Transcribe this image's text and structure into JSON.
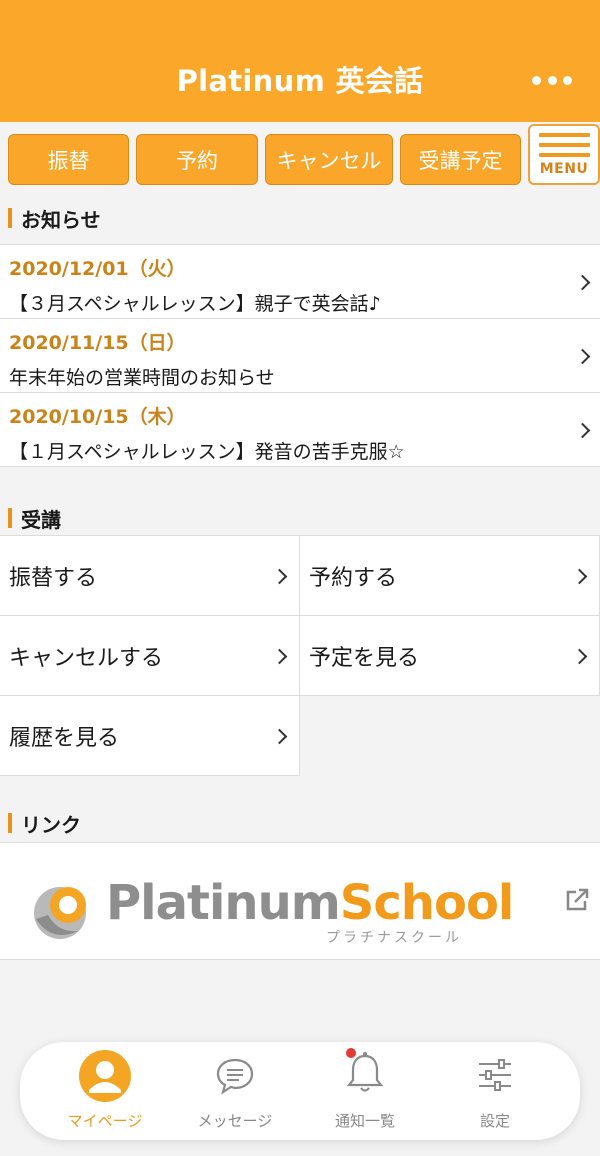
{
  "header": {
    "title": "Platinum 英会話",
    "more_icon": "more-dots-icon"
  },
  "quick_buttons": [
    "振替",
    "予約",
    "キャンセル",
    "受講予定"
  ],
  "menu_button": {
    "label": "MENU",
    "icon": "hamburger-icon"
  },
  "sections": {
    "news": "お知らせ",
    "course": "受講",
    "links": "リンク"
  },
  "news": [
    {
      "date": "2020/12/01（火）",
      "title": "【３月スペシャルレッスン】親子で英会話♪"
    },
    {
      "date": "2020/11/15（日）",
      "title": "年末年始の営業時間のお知らせ"
    },
    {
      "date": "2020/10/15（木）",
      "title": "【１月スペシャルレッスン】発音の苦手克服☆"
    }
  ],
  "course_items": [
    "振替する",
    "予約する",
    "キャンセルする",
    "予定を見る",
    "履歴を見る"
  ],
  "link_banner": {
    "brand_part1": "Platinum",
    "brand_part2": "School",
    "kana": "プラチナスクール",
    "external_icon": "external-link-icon"
  },
  "tabs": [
    {
      "label": "マイページ",
      "icon": "user-icon",
      "active": true
    },
    {
      "label": "メッセージ",
      "icon": "message-icon",
      "active": false
    },
    {
      "label": "通知一覧",
      "icon": "bell-icon",
      "active": false,
      "badge": true
    },
    {
      "label": "設定",
      "icon": "sliders-icon",
      "active": false
    }
  ],
  "colors": {
    "primary": "#fba72a",
    "accent_text": "#c98318",
    "badge": "#e53935"
  }
}
